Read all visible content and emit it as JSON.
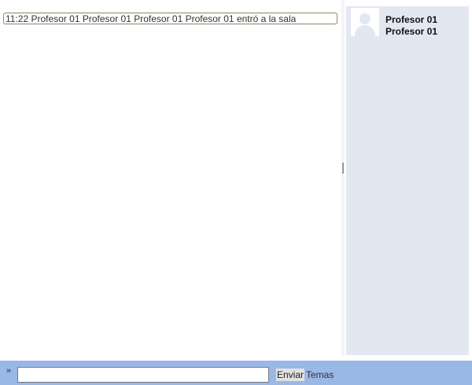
{
  "messages": [
    {
      "time": "11:22",
      "text": "Profesor 01 Profesor 01 Profesor 01 Profesor 01 entró a la sala",
      "full": "11:22 Profesor 01 Profesor 01 Profesor 01 Profesor 01 entró a la sala"
    }
  ],
  "users": [
    {
      "name_line1": "Profesor 01",
      "name_line2": "Profesor 01",
      "avatar_icon": "user-silhouette-icon"
    }
  ],
  "input": {
    "prompt": "»",
    "value": "",
    "placeholder": ""
  },
  "buttons": {
    "send": "Enviar",
    "topics": "Temas"
  },
  "colors": {
    "users_panel_bg": "#e3e7f1",
    "bottom_bar_bg": "#9ab8e6",
    "message_border": "#8c8466"
  }
}
